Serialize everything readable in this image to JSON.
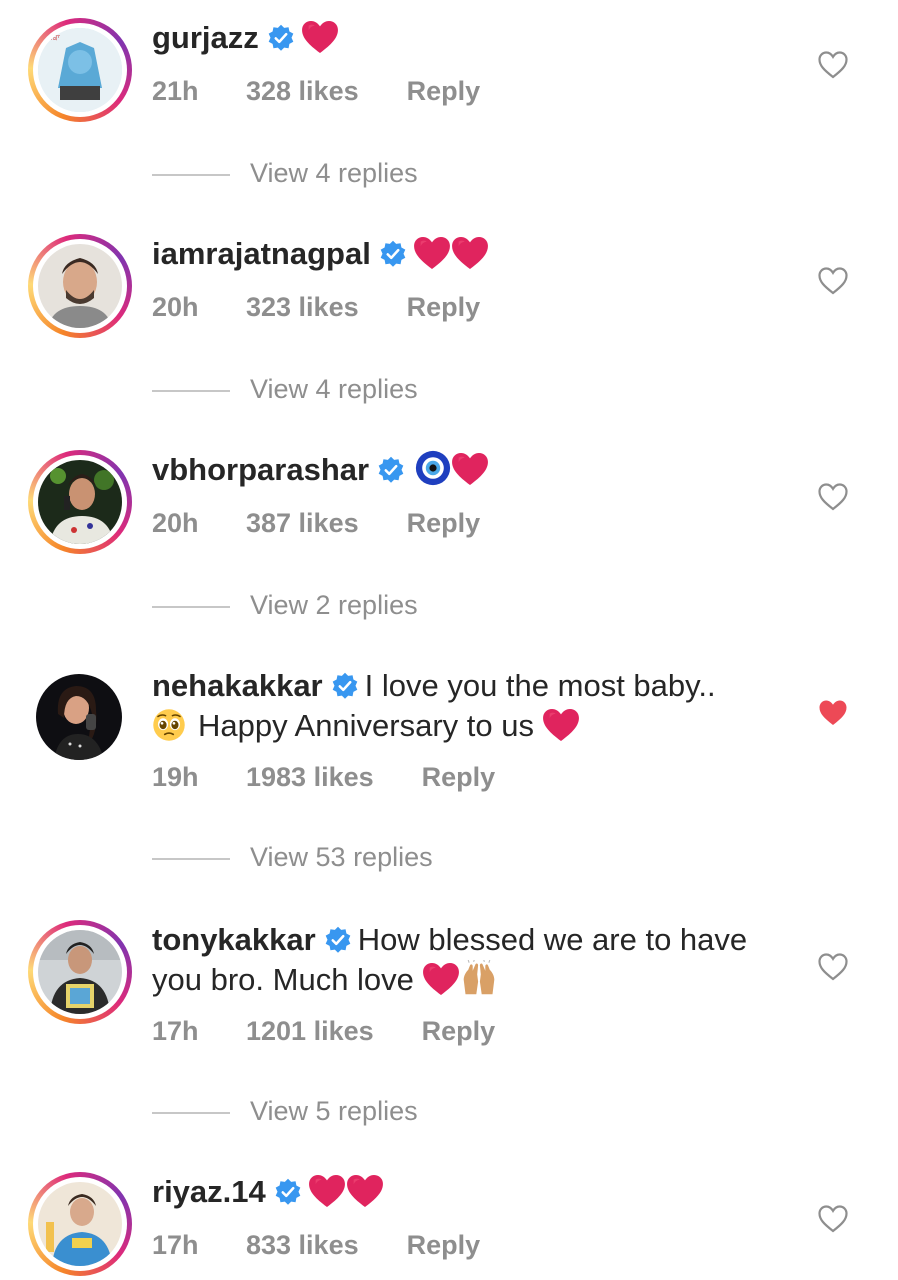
{
  "comments": [
    {
      "username": "gurjazz",
      "text": "",
      "emojis": [
        "red-heart"
      ],
      "time": "21h",
      "likes": "328 likes",
      "reply": "Reply",
      "liked": false,
      "view_replies": "View 4 replies"
    },
    {
      "username": "iamrajatnagpal",
      "text": "",
      "emojis": [
        "red-heart",
        "red-heart"
      ],
      "time": "20h",
      "likes": "323 likes",
      "reply": "Reply",
      "liked": false,
      "view_replies": "View 4 replies"
    },
    {
      "username": "vbhorparashar",
      "text": "",
      "emojis": [
        "nazar-amulet",
        "red-heart"
      ],
      "time": "20h",
      "likes": "387 likes",
      "reply": "Reply",
      "liked": false,
      "view_replies": "View 2 replies"
    },
    {
      "username": "nehakakkar",
      "text_line1": "I love you the most baby..",
      "text_line2": "Happy Anniversary to us",
      "emojis": [
        "pleading-face",
        "red-heart"
      ],
      "time": "19h",
      "likes": "1983 likes",
      "reply": "Reply",
      "liked": true,
      "view_replies": "View 53 replies"
    },
    {
      "username": "tonykakkar",
      "text_line1": "How blessed we are to have",
      "text_line2": "you bro. Much love",
      "emojis": [
        "red-heart",
        "raising-hands"
      ],
      "time": "17h",
      "likes": "1201 likes",
      "reply": "Reply",
      "liked": false,
      "view_replies": "View 5 replies"
    },
    {
      "username": "riyaz.14",
      "text": "",
      "emojis": [
        "red-heart",
        "red-heart"
      ],
      "time": "17h",
      "likes": "833 likes",
      "reply": "Reply",
      "liked": false,
      "view_replies": ""
    }
  ],
  "colors": {
    "text": "#262626",
    "meta": "#8e8e8e",
    "verified": "#3897f0",
    "like_red": "#ed4956"
  }
}
